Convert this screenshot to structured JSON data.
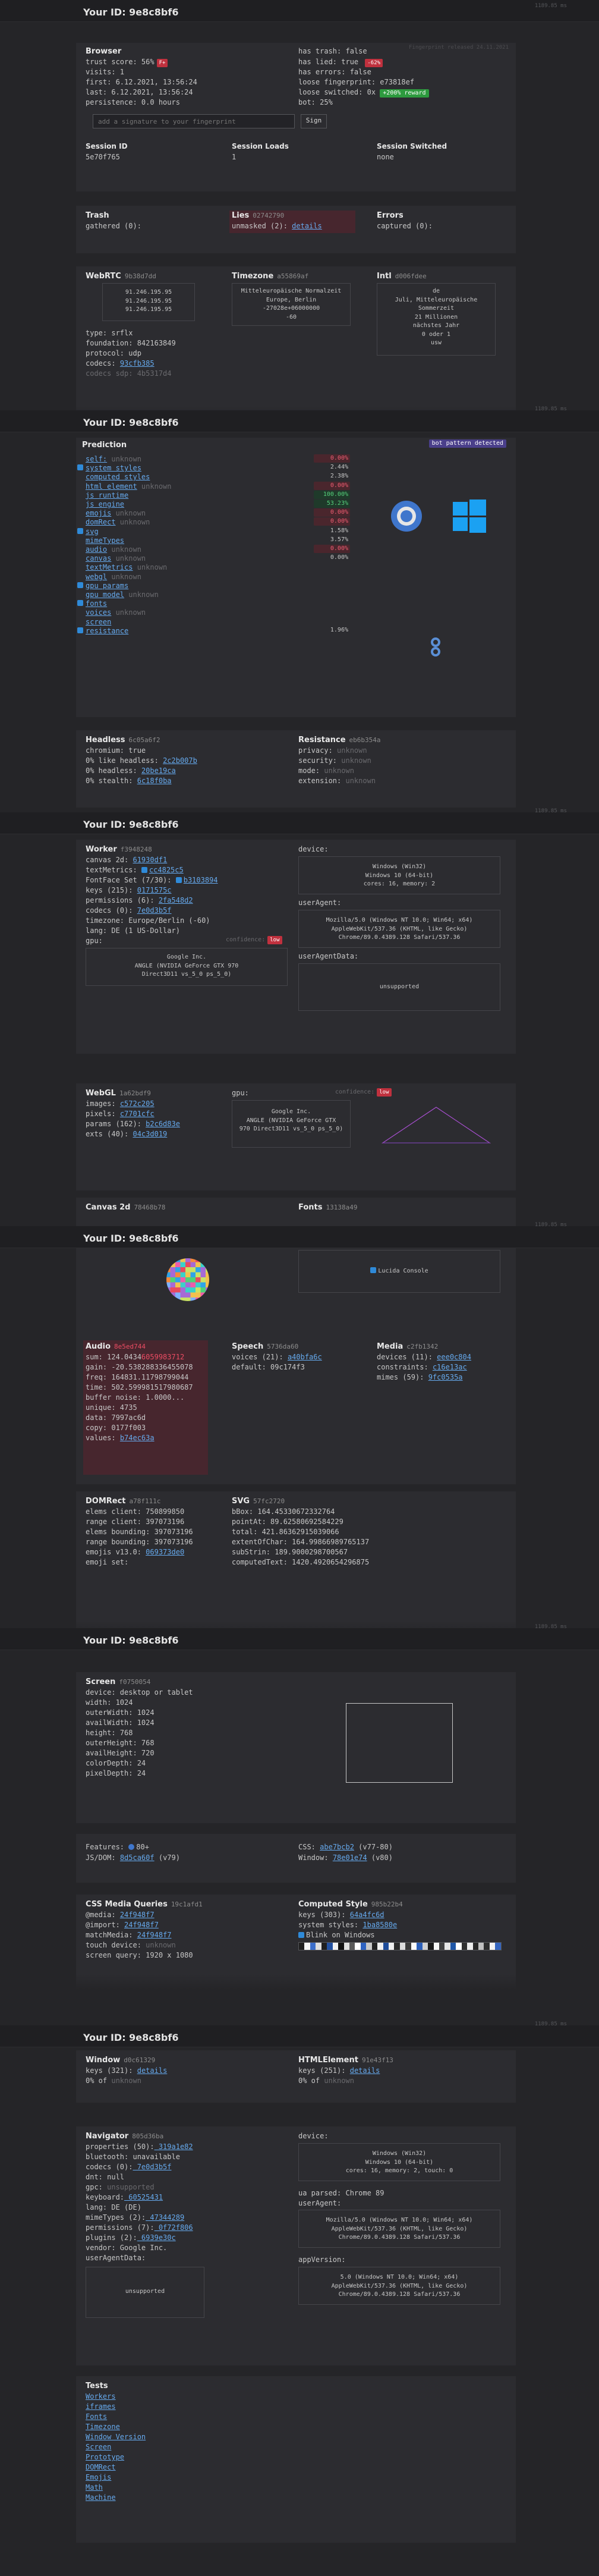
{
  "timestamp": "1189.85 ms",
  "id_title": "Your ID: 9e8c8bf6",
  "p1": {
    "watermark": "Fingerprint released 24.11.2021",
    "browser_t": "Browser",
    "trust": "trust score: 56%",
    "trust_grade": "F+",
    "visits": "visits: 1",
    "first": "first: 6.12.2021, 13:56:24",
    "last": "last: 6.12.2021, 13:56:24",
    "persistence": "persistence: 0.0 hours",
    "has_trash": "has trash: false",
    "has_lied_a": "has lied: true",
    "has_lied_pct": "-62%",
    "has_errors": "has errors: false",
    "loose_fp_a": "loose fingerprint:",
    "loose_fp_b": "e73818ef",
    "loose_sw_a": "loose switched: 0x",
    "loose_reward": "+200% reward",
    "bot": "bot: 25%",
    "sig_placeholder": "add a signature to your fingerprint",
    "sign": "Sign",
    "sess_id_t": "Session ID",
    "sess_id": "5e70f765",
    "sess_loads_t": "Session Loads",
    "sess_loads": "1",
    "sess_sw_t": "Session Switched",
    "sess_sw": "none",
    "trash_t": "Trash",
    "trash_v": "gathered (0):",
    "lies_t": "Lies",
    "lies_hash": "02742790",
    "lies_v": "unmasked (2):",
    "lies_link": "details",
    "errors_t": "Errors",
    "errors_v": "captured (0):",
    "webrtc_t": "WebRTC",
    "webrtc_hash": "9b38d7dd",
    "webrtc_ips": [
      "91.246.195.95",
      "91.246.195.95",
      "91.246.195.95"
    ],
    "webrtc_type": "type: srflx",
    "webrtc_found": "foundation: 842163849",
    "webrtc_proto": "protocol: udp",
    "webrtc_codecs": "codecs:",
    "webrtc_codecs_v": "93cfb385",
    "webrtc_more": "codecs sdp: 4b5317d4",
    "tz_t": "Timezone",
    "tz_hash": "a55869af",
    "tz_lines": [
      "Mitteleuropäische Normalzeit",
      "Europe, Berlin",
      "-27028e+06000000",
      "-60"
    ],
    "intl_t": "Intl",
    "intl_hash": "d006fdee",
    "intl_lines": [
      "de",
      "Juli, Mitteleuropäische",
      "Sommerzeit",
      "21 Millionen",
      "nächstes Jahr",
      "0 oder 1",
      "usw"
    ]
  },
  "p2": {
    "watermark": "bot pattern detected",
    "pred_t": "Prediction",
    "rows": [
      {
        "lb": "self:",
        "st": "unknown",
        "v": "0.00%",
        "c": "r",
        "ic": ""
      },
      {
        "lb": "system styles",
        "st": "",
        "v": "2.44%",
        "c": "n",
        "ic": "win"
      },
      {
        "lb": "computed styles",
        "st": "",
        "v": "2.38%",
        "c": "n",
        "ic": ""
      },
      {
        "lb": "html element",
        "st": "unknown",
        "v": "0.00%",
        "c": "r",
        "ic": ""
      },
      {
        "lb": "js runtime",
        "st": "",
        "v": "100.00%",
        "c": "g",
        "ic": ""
      },
      {
        "lb": "js engine",
        "st": "",
        "v": "53.23%",
        "c": "g",
        "ic": ""
      },
      {
        "lb": "emojis",
        "st": "unknown",
        "v": "0.00%",
        "c": "r",
        "ic": ""
      },
      {
        "lb": "domRect",
        "st": "unknown",
        "v": "0.00%",
        "c": "r",
        "ic": ""
      },
      {
        "lb": "svg",
        "st": "",
        "v": "1.58%",
        "c": "n",
        "ic": "win"
      },
      {
        "lb": "mimeTypes",
        "st": "",
        "v": "3.57%",
        "c": "n",
        "ic": ""
      },
      {
        "lb": "audio",
        "st": "unknown",
        "v": "0.00%",
        "c": "r",
        "ic": ""
      },
      {
        "lb": "canvas",
        "st": "unknown",
        "v": "0.00%",
        "c": "u",
        "ic": ""
      },
      {
        "lb": "textMetrics",
        "st": "unknown",
        "v": "",
        "c": "n",
        "ic": ""
      },
      {
        "lb": "webgl",
        "st": "unknown",
        "v": "",
        "c": "n",
        "ic": ""
      },
      {
        "lb": "gpu params",
        "st": "",
        "v": "",
        "c": "n",
        "ic": "win"
      },
      {
        "lb": "gpu model",
        "st": "unknown",
        "v": "",
        "c": "n",
        "ic": ""
      },
      {
        "lb": "fonts",
        "st": "",
        "v": "",
        "c": "n",
        "ic": "win"
      },
      {
        "lb": "voices",
        "st": "unknown",
        "v": "",
        "c": "n",
        "ic": ""
      },
      {
        "lb": "screen",
        "st": "",
        "v": "",
        "c": "n",
        "ic": ""
      },
      {
        "lb": "resistance",
        "st": "",
        "v": "1.96%",
        "c": "n",
        "ic": "win"
      }
    ],
    "headless_t": "Headless",
    "headless_hash": "6c05a6f2",
    "chromium": "chromium: true",
    "like_headless": "0% like headless:",
    "like_headless_v": "2c2b007b",
    "pct_headless": "0% headless:",
    "pct_headless_v": "20be19ca",
    "stealth": "0% stealth:",
    "stealth_v": "6c18f0ba",
    "resist_t": "Resistance",
    "resist_hash": "eb6b354a",
    "privacy": "privacy:",
    "security": "security:",
    "mode": "mode:",
    "extension": "extension:",
    "unknown": "unknown"
  },
  "p3": {
    "worker_t": "Worker",
    "worker_hash": "f3948248",
    "canvas2d": "canvas 2d:",
    "canvas2d_v": "61930df1",
    "textMetrics": "textMetrics:",
    "textMetrics_v": "cc4825c5",
    "fontface": "FontFace Set (7/30):",
    "fontface_v": "b3103894",
    "keys": "keys (215):",
    "keys_v": "0171575c",
    "permissions": "permissions (6):",
    "permissions_v": "2fa548d2",
    "codecs": "codecs (0):",
    "codecs_v": "7e0d3b5f",
    "timezone": "timezone: Europe/Berlin (-60)",
    "lang": "lang: DE (1 US-Dollar)",
    "gpu": "gpu:",
    "conf": "confidence:",
    "conf_low": "low",
    "gpu_lines": [
      "Google Inc.",
      "ANGLE (NVIDIA GeForce GTX 970 Direct3D11 vs_5_0 ps_5_0)"
    ],
    "device": "device:",
    "device_lines": [
      "Windows (Win32)",
      "Windows 10 (64-bit)",
      "cores: 16, memory: 2"
    ],
    "ua": "userAgent:",
    "ua_lines": [
      "Mozilla/5.0 (Windows NT 10.0; Win64; x64)",
      "AppleWebKit/537.36 (KHTML, like Gecko)",
      "Chrome/89.0.4389.128 Safari/537.36"
    ],
    "uadata": "userAgentData:",
    "unsupported": "unsupported",
    "webgl_t": "WebGL",
    "webgl_hash": "1a62bdf9",
    "images": "images:",
    "images_v": "c572c205",
    "pixels": "pixels:",
    "pixels_v": "c7701cfc",
    "params": "params (162):",
    "params_v": "b2c6d83e",
    "exts": "exts (40):",
    "exts_v": "04c3d019",
    "wgpu": "gpu:",
    "wgpu_lines": [
      "Google Inc.",
      "ANGLE (NVIDIA GeForce GTX",
      "970 Direct3D11 vs_5_0 ps_5_0)"
    ],
    "canvas_t": "Canvas 2d",
    "canvas_hash": "78468b78",
    "fonts_t": "Fonts",
    "fonts_hash": "13138a49"
  },
  "p4": {
    "lucida": "Lucida Console",
    "audio_t": "Audio",
    "audio_hash": "8e5ed744",
    "sum": "sum: 124.0434",
    "sum_red": "6059983712",
    "gain": "gain: -20.538288336455078",
    "freq": "freq: 164831.11798799044",
    "time": "time: 502.599981517980687",
    "buffer": "buffer noise: 1.0000...",
    "unique": "unique: 4735",
    "data": "data: 7997ac6d",
    "copy": "copy: 0177f003",
    "values": "values:",
    "values_v": "b74ec63a",
    "speech_t": "Speech",
    "speech_hash": "5736da60",
    "voices": "voices (21):",
    "voices_v": "a40bfa6c",
    "sdefault": "default: 09c174f3",
    "media_t": "Media",
    "media_hash": "c2fb1342",
    "devices": "devices (11):",
    "devices_v": "eee0c804",
    "constraints": "constraints:",
    "constraints_v": "c16e13ac",
    "mimes": "mimes (59):",
    "mimes_v": "9fc0535a",
    "domrect_t": "DOMRect",
    "domrect_hash": "a78f111c",
    "dr_rows": [
      "elems client: 750899850",
      "range client: 397073196",
      "elems bounding: 397073196",
      "range bounding: 397073196"
    ],
    "dr_emojis": "emojis v13.0:",
    "dr_emojis_v": "069373de0",
    "dr_emoji_set": "emoji set:",
    "svg_t": "SVG",
    "svg_hash": "57fc2720",
    "svg_rows": [
      "bBox: 164.45330672332764",
      "pointAt: 89.62580692584229",
      "total: 421.86362915039066",
      "extentOfChar: 164.99866989765137",
      "subStrin: 189.9000298700567",
      "computedText: 1420.4920654296875"
    ]
  },
  "p5": {
    "screen_t": "Screen",
    "screen_hash": "f0750054",
    "scr_rows": [
      "device: desktop or tablet",
      "width: 1024",
      "outerWidth: 1024",
      "availWidth: 1024",
      "height: 768",
      "outerHeight: 768",
      "availHeight: 720",
      "colorDepth: 24",
      "pixelDepth: 24"
    ],
    "features": "Features:",
    "features_v": "80+",
    "jsdom": "JS/DOM:",
    "jsdom_v": "8d5ca60f",
    "jsdom_s": "(v79)",
    "css": "CSS:",
    "css_v": "abe7bcb2",
    "css_s": "(v77-80)",
    "window": "Window:",
    "window_v": "78e01e74",
    "window_s": "(v80)",
    "cssmq_t": "CSS Media Queries",
    "cssmq_hash": "19c1afd1",
    "media": "@media:",
    "media_v": "24f948f7",
    "import": "@import:",
    "import_v": "24f948f7",
    "matchmedia": "matchMedia:",
    "matchmedia_v": "24f948f7",
    "touch": "touch device:",
    "touch_v": "unknown",
    "screen_query": "screen query: 1920 x 1080",
    "cstyle_t": "Computed Style",
    "cstyle_hash": "985b22b4",
    "ckeys": "keys (303):",
    "ckeys_v": "64a4fc6d",
    "csys": "system styles:",
    "csys_v": "1ba8580e",
    "blink": "Blink on Windows",
    "strip": [
      "#1f1f1f",
      "#f5f5f5",
      "#3b6ecb",
      "#dddddd",
      "#1f1f1f",
      "#2250a0",
      "#f2f2f2",
      "#111111",
      "#e0e0e0",
      "#5a5a5a",
      "#ffffff",
      "#2e63c2",
      "#c8c8c8",
      "#222222",
      "#f0f0f0",
      "#1e4c9a",
      "#eeeeee",
      "#2a2a2a",
      "#dcdcdc",
      "#3a3a3a",
      "#fafafa",
      "#2c5fb8",
      "#d0d0d0",
      "#1a1a1a",
      "#f7f7f7",
      "#404040",
      "#e6e6e6",
      "#1f57a8",
      "#ffffff",
      "#303030",
      "#ececec",
      "#272727",
      "#c0c0c0",
      "#2d2d2d",
      "#f4f4f4",
      "#3566c0"
    ]
  },
  "p6": {
    "win_t": "Window",
    "win_hash": "d0c61329",
    "win_keys": "keys (321):",
    "win_keys_v": "details",
    "win_pct": "0% of",
    "win_pct_v": "unknown",
    "html_t": "HTMLElement",
    "html_hash": "91e43f13",
    "html_keys": "keys (251):",
    "html_keys_v": "details",
    "html_pct": "0% of",
    "html_pct_v": "unknown",
    "nav_t": "Navigator",
    "nav_hash": "805d36ba",
    "nav_rows": [
      {
        "k": "properties (50):",
        "v": "319a1e82"
      },
      {
        "k": "bluetooth:",
        "v": "unavailable",
        "plain": true
      },
      {
        "k": "codecs (0):",
        "v": "7e0d3b5f"
      },
      {
        "k": "dnt: null",
        "v": "",
        "plain": true
      },
      {
        "k": "gpc:",
        "v": "unsupported",
        "dim": true
      },
      {
        "k": "keyboard:",
        "v": "60525431"
      },
      {
        "k": "lang: DE",
        "v": "(DE)",
        "plain": true
      },
      {
        "k": "mimeTypes (2):",
        "v": "47344289"
      },
      {
        "k": "permissions (7):",
        "v": "0f72f806"
      },
      {
        "k": "plugins (2):",
        "v": "6939e30c"
      },
      {
        "k": "vendor: Google Inc.",
        "v": "",
        "plain": true
      },
      {
        "k": "userAgentData:",
        "v": "",
        "plain": true
      }
    ],
    "unsupported": "unsupported",
    "ndevice": "device:",
    "ndevice_lines": [
      "Windows (Win32)",
      "Windows 10 (64-bit)",
      "cores: 16, memory: 2, touch: 0"
    ],
    "ua_parsed": "ua parsed: Chrome 89",
    "nua": "userAgent:",
    "nua_lines": [
      "Mozilla/5.0 (Windows NT 10.0; Win64; x64)",
      "AppleWebKit/537.36 (KHTML, like Gecko)",
      "Chrome/89.0.4389.128 Safari/537.36"
    ],
    "appversion": "appVersion:",
    "appver_lines": [
      "5.0 (Windows NT 10.0; Win64; x64)",
      "AppleWebKit/537.36 (KHTML, like Gecko)",
      "Chrome/89.0.4389.128 Safari/537.36"
    ],
    "tests_t": "Tests",
    "tests": [
      "Workers",
      "iframes",
      "Fonts",
      "Timezone",
      "Window Version",
      "Screen",
      "Prototype",
      "DOMRect",
      "Emojis",
      "Math",
      "Machine"
    ]
  }
}
